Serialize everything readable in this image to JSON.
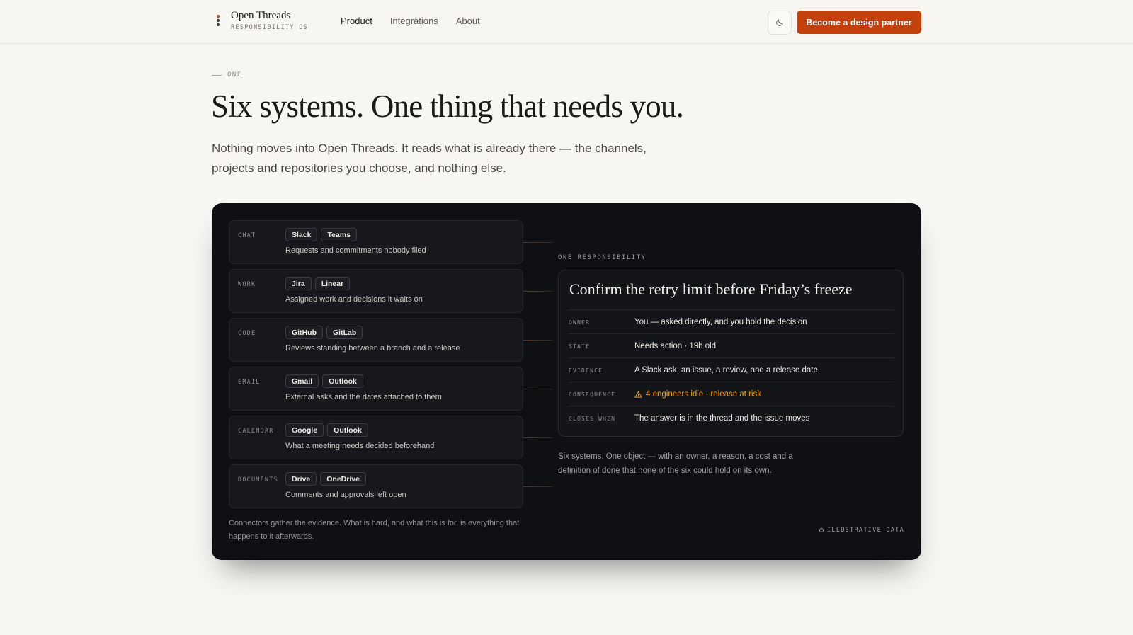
{
  "header": {
    "brand_name": "Open Threads",
    "brand_sub": "RESPONSIBILITY OS",
    "nav": [
      {
        "label": "Product"
      },
      {
        "label": "Integrations"
      },
      {
        "label": "About"
      }
    ],
    "active_nav": "Product",
    "theme_toggle_icon": "moon-icon",
    "cta_label": "Become a design partner"
  },
  "hero": {
    "eyebrow": "ONE",
    "headline": "Six systems. One thing that needs you.",
    "lede": "Nothing moves into Open Threads. It reads what is already there — the channels, projects and repositories you choose, and nothing else."
  },
  "panel": {
    "sources": [
      {
        "category": "CHAT",
        "chips": [
          "Slack",
          "Teams"
        ],
        "desc": "Requests and commitments nobody filed"
      },
      {
        "category": "WORK",
        "chips": [
          "Jira",
          "Linear"
        ],
        "desc": "Assigned work and decisions it waits on"
      },
      {
        "category": "CODE",
        "chips": [
          "GitHub",
          "GitLab"
        ],
        "desc": "Reviews standing between a branch and a release"
      },
      {
        "category": "EMAIL",
        "chips": [
          "Gmail",
          "Outlook"
        ],
        "desc": "External asks and the dates attached to them"
      },
      {
        "category": "CALENDAR",
        "chips": [
          "Google",
          "Outlook"
        ],
        "desc": "What a meeting needs decided beforehand"
      },
      {
        "category": "DOCUMENTS",
        "chips": [
          "Drive",
          "OneDrive"
        ],
        "desc": "Comments and approvals left open"
      }
    ],
    "sources_note": "Connectors gather the evidence. What is hard, and what this is for, is everything that happens to it afterwards.",
    "responsibility_label": "ONE RESPONSIBILITY",
    "responsibility": {
      "title": "Confirm the retry limit before Friday’s freeze",
      "rows": [
        {
          "key": "OWNER",
          "value": "You — asked directly, and you hold the decision"
        },
        {
          "key": "STATE",
          "value": "Needs action · 19h old"
        },
        {
          "key": "EVIDENCE",
          "value": "A Slack ask, an issue, a review, and a release date"
        },
        {
          "key": "CONSEQUENCE",
          "value": "4 engineers idle · release at risk",
          "icon": "warning-icon"
        },
        {
          "key": "CLOSES WHEN",
          "value": "The answer is in the thread and the issue moves"
        }
      ]
    },
    "responsibility_note": "Six systems. One object — with an owner, a reason, a cost and a definition of done that none of the six could hold on its own.",
    "badge": "ILLUSTRATIVE DATA"
  },
  "colors": {
    "accent": "#c2410c",
    "page_bg": "#f7f6f3",
    "panel_bg": "#0f1013",
    "warning": "#f59e0b"
  }
}
